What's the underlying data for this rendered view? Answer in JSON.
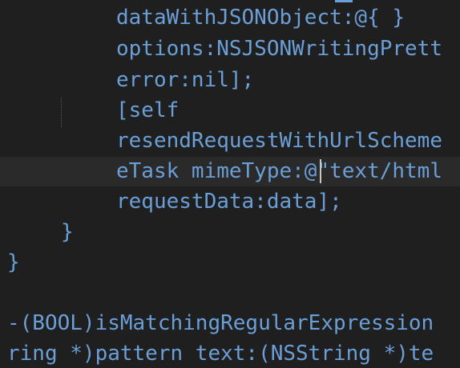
{
  "editor": {
    "lines": [
      "dataWithJSONObject:@{ }",
      "options:NSJSONWritingPrett",
      "error:nil];",
      "[self",
      "resendRequestWithUrlScheme",
      "eTask mimeType:@\"text/html",
      "requestData:data];",
      "}",
      "}",
      "",
      "-(BOOL)isMatchingRegularExpression",
      "ring *)pattern text:(NSString *)te"
    ]
  }
}
